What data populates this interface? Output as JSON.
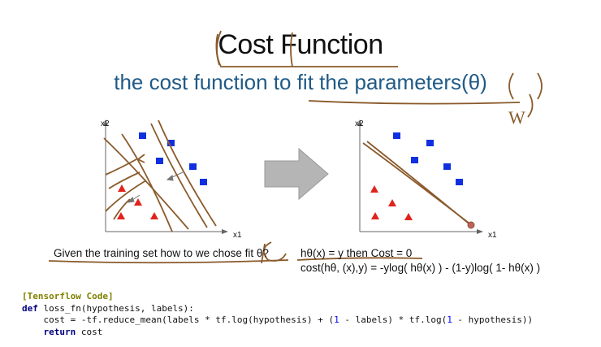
{
  "slide": {
    "title": "Cost Function",
    "subtitle": "the cost function to fit the parameters(θ)",
    "annotation_handwriting": "W"
  },
  "plots": {
    "left": {
      "y_axis_label": "x2",
      "x_axis_label": "x1"
    },
    "right": {
      "y_axis_label": "x2",
      "x_axis_label": "x1"
    }
  },
  "text": {
    "given": "Given the training set how to we chose fit θ?",
    "hypothesis": "hθ(x) = y then Cost = 0",
    "cost": "cost(hθ, (x),y) = -ylog( hθ(x) ) - (1-y)log( 1- hθ(x) )"
  },
  "code": {
    "header": "[Tensorflow Code]",
    "line1_kw": "def",
    "line1_rest": " loss_fn(hypothesis, labels):",
    "line2_a": "    cost = -tf.reduce_mean(labels * tf.log(hypothesis) + (",
    "line2_n1": "1",
    "line2_b": " - labels) * tf.log(",
    "line2_n2": "1",
    "line2_c": " - hypothesis))",
    "line3_kw": "    return",
    "line3_rest": " cost"
  },
  "colors": {
    "title": "#111111",
    "subtitle": "#1f5a86",
    "pen": "#8a5a2b",
    "square": "#1030e0",
    "triangle": "#e0241c",
    "arrow": "#a8a8a8"
  }
}
